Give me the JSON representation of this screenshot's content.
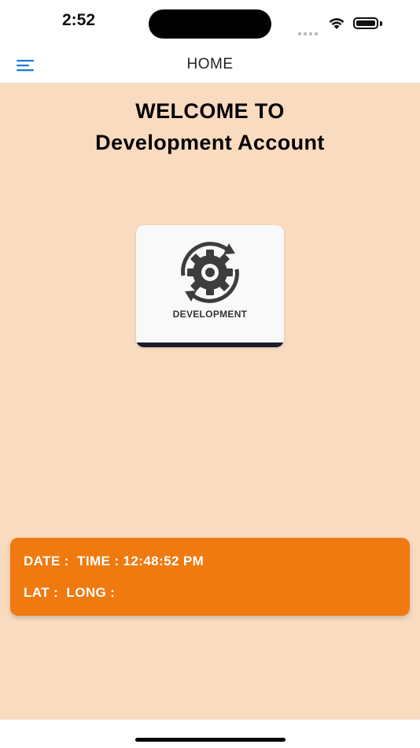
{
  "status_bar": {
    "time": "2:52"
  },
  "navbar": {
    "menu_icon": "hamburger-menu-icon",
    "title": "HOME",
    "accent_color": "#1a7ad6"
  },
  "main": {
    "welcome_line1": "WELCOME TO",
    "welcome_line2": "Development Account",
    "background_color": "#f9dbc0",
    "account_card": {
      "icon": "gear-cycle-icon",
      "label": "DEVELOPMENT"
    },
    "info_card": {
      "color": "#ef7a10",
      "date_time_text": "DATE :  TIME : 12:48:52 PM",
      "lat_long_text": "LAT :  LONG :"
    }
  }
}
